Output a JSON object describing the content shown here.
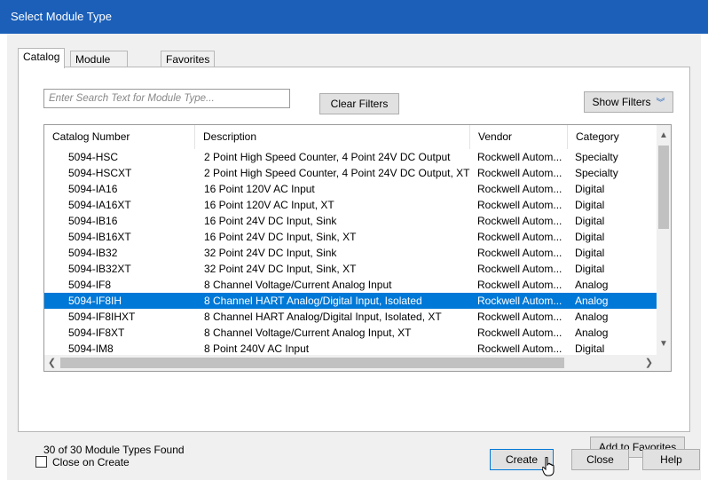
{
  "window": {
    "title": "Select Module Type"
  },
  "tabs": [
    {
      "label": "Catalog",
      "active": true
    },
    {
      "label": "Module Discovery",
      "active": false
    },
    {
      "label": "Favorites",
      "active": false
    }
  ],
  "search": {
    "placeholder": "Enter Search Text for Module Type...",
    "value": ""
  },
  "buttons": {
    "clear_filters": "Clear Filters",
    "show_filters": "Show Filters",
    "show_filters_icon": "double-chevron-down-icon",
    "add_to_favorites": "Add to Favorites",
    "create": "Create",
    "close": "Close",
    "help": "Help"
  },
  "table": {
    "columns": [
      "Catalog Number",
      "Description",
      "Vendor",
      "Category"
    ],
    "rows": [
      {
        "catalog": "5094-HSC",
        "description": "2 Point High Speed Counter, 4 Point 24V DC Output",
        "vendor": "Rockwell Autom...",
        "category": "Specialty"
      },
      {
        "catalog": "5094-HSCXT",
        "description": "2 Point High Speed Counter, 4 Point 24V DC Output, XT",
        "vendor": "Rockwell Autom...",
        "category": "Specialty"
      },
      {
        "catalog": "5094-IA16",
        "description": "16 Point 120V AC Input",
        "vendor": "Rockwell Autom...",
        "category": "Digital"
      },
      {
        "catalog": "5094-IA16XT",
        "description": "16 Point 120V AC Input, XT",
        "vendor": "Rockwell Autom...",
        "category": "Digital"
      },
      {
        "catalog": "5094-IB16",
        "description": "16 Point 24V DC Input, Sink",
        "vendor": "Rockwell Autom...",
        "category": "Digital"
      },
      {
        "catalog": "5094-IB16XT",
        "description": "16 Point 24V DC Input, Sink, XT",
        "vendor": "Rockwell Autom...",
        "category": "Digital"
      },
      {
        "catalog": "5094-IB32",
        "description": "32 Point 24V DC Input, Sink",
        "vendor": "Rockwell Autom...",
        "category": "Digital"
      },
      {
        "catalog": "5094-IB32XT",
        "description": "32 Point 24V DC Input, Sink, XT",
        "vendor": "Rockwell Autom...",
        "category": "Digital"
      },
      {
        "catalog": "5094-IF8",
        "description": "8 Channel Voltage/Current Analog Input",
        "vendor": "Rockwell Autom...",
        "category": "Analog"
      },
      {
        "catalog": "5094-IF8IH",
        "description": "8 Channel HART Analog/Digital Input, Isolated",
        "vendor": "Rockwell Autom...",
        "category": "Analog",
        "selected": true
      },
      {
        "catalog": "5094-IF8IHXT",
        "description": "8 Channel HART Analog/Digital Input, Isolated, XT",
        "vendor": "Rockwell Autom...",
        "category": "Analog"
      },
      {
        "catalog": "5094-IF8XT",
        "description": "8 Channel Voltage/Current Analog Input, XT",
        "vendor": "Rockwell Autom...",
        "category": "Analog"
      },
      {
        "catalog": "5094-IM8",
        "description": "8 Point 240V AC Input",
        "vendor": "Rockwell Autom...",
        "category": "Digital"
      }
    ]
  },
  "status": {
    "found_text": "30 of 30 Module Types Found"
  },
  "close_on_create": {
    "label": "Close on Create",
    "checked": false
  },
  "colors": {
    "titlebar": "#1b5fb8",
    "selection": "#0078d7",
    "dialog_bg": "#f0f0f0"
  }
}
